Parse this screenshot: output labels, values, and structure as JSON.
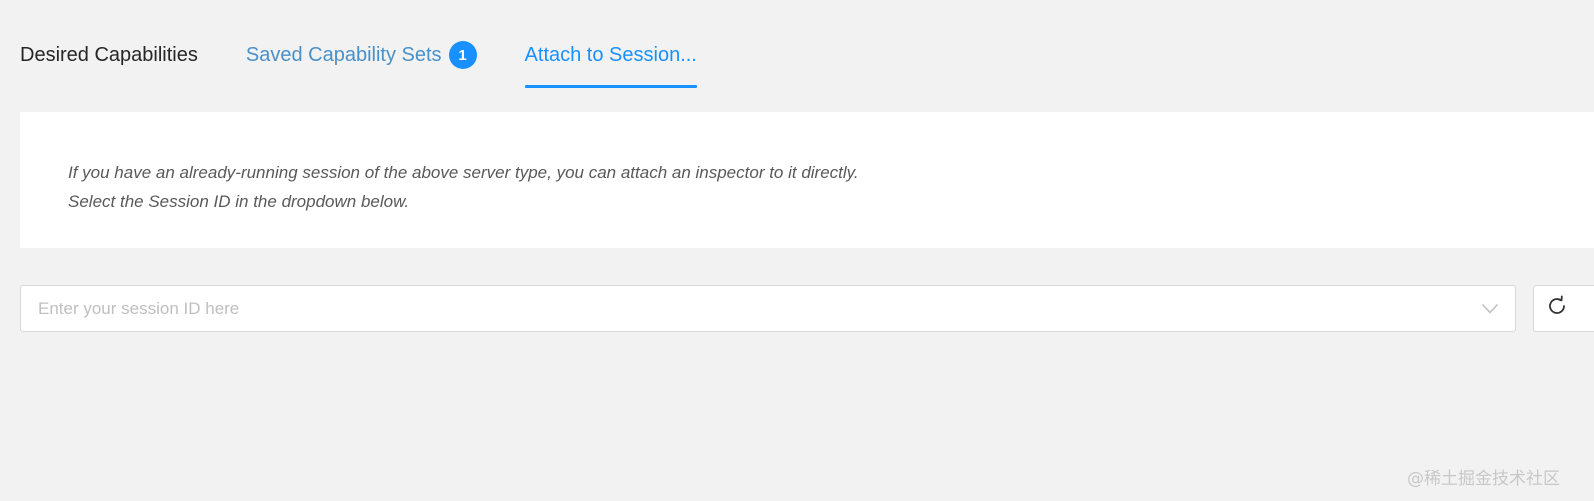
{
  "tabs": {
    "desired": "Desired Capabilities",
    "saved": "Saved Capability Sets",
    "saved_count": "1",
    "attach": "Attach to Session..."
  },
  "info": {
    "line1": "If you have an already-running session of the above server type, you can attach an inspector to it directly.",
    "line2": "Select the Session ID in the dropdown below."
  },
  "session": {
    "placeholder": "Enter your session ID here",
    "value": ""
  },
  "icons": {
    "dropdown": "chevron-down-icon",
    "refresh": "refresh-icon"
  },
  "colors": {
    "accent": "#1890ff",
    "background": "#f2f2f2"
  },
  "watermark": "@稀土掘金技术社区"
}
